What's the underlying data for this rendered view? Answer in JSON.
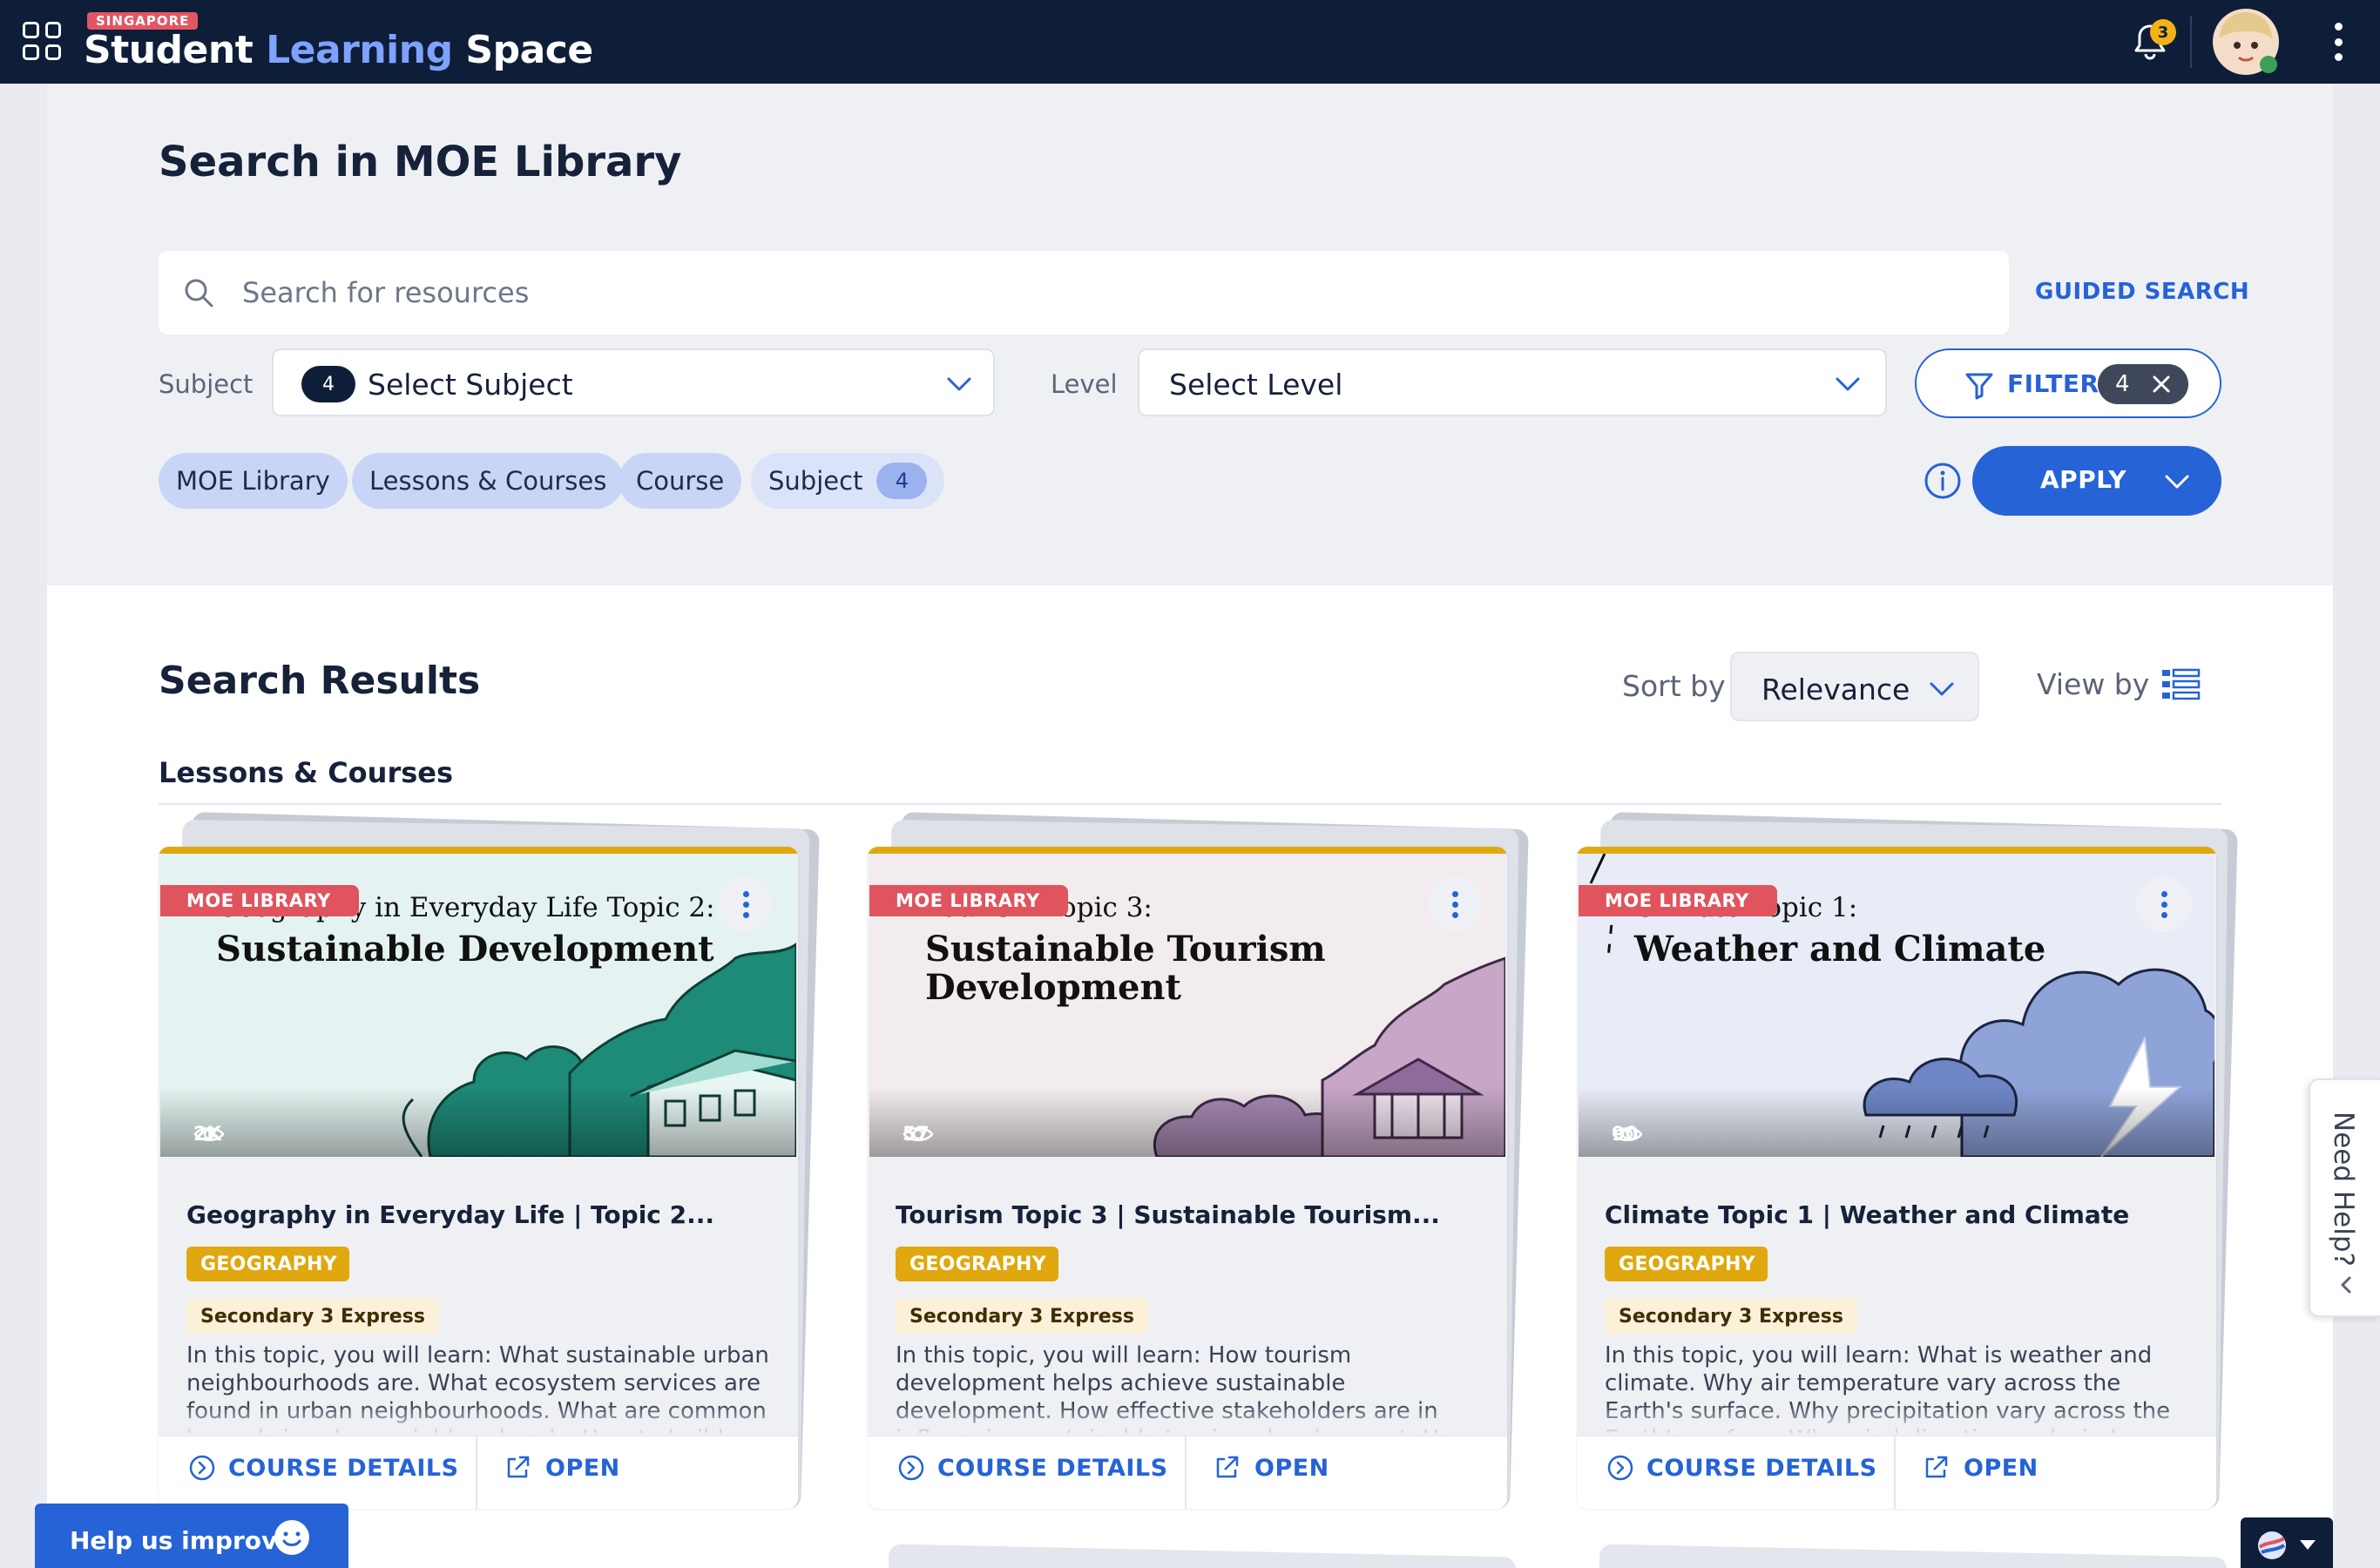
{
  "topbar": {
    "brand_tag": "SINGAPORE",
    "brand_word1": "Student",
    "brand_word2": "Learning",
    "brand_word3": "Space",
    "notification_count": "3",
    "colors": {
      "bar": "#0e1e38",
      "accent": "#7ea2ff",
      "badge": "#f3b21a"
    }
  },
  "search": {
    "page_title": "Search in MOE Library",
    "placeholder": "Search for resources",
    "value": "",
    "guided_search_label": "GUIDED SEARCH",
    "subject_label": "Subject",
    "subject_count": "4",
    "subject_select": "Select Subject",
    "level_label": "Level",
    "level_select": "Select Level",
    "filter_label": "FILTER",
    "filter_count": "4",
    "apply_label": "APPLY"
  },
  "chips": [
    {
      "label": "MOE Library"
    },
    {
      "label": "Lessons & Courses"
    },
    {
      "label": "Course"
    },
    {
      "label": "Subject",
      "count": "4"
    }
  ],
  "results": {
    "title": "Search Results",
    "sort_label": "Sort by",
    "sort_value": "Relevance",
    "view_label": "View by",
    "section_label": "Lessons & Courses",
    "course_details_label": "COURSE DETAILS",
    "open_label": "OPEN",
    "cards": [
      {
        "badge": "MOE LIBRARY",
        "thumb_kicker": "Geography in Everyday Life Topic 2:",
        "thumb_heading": "Sustainable Development",
        "views": "2K",
        "title": "Geography in Everyday Life | Topic 2...",
        "subject": "GEOGRAPHY",
        "level": "Secondary 3 Express",
        "description": "In this topic, you will learn: What sustainable urban neighbourhoods are. What ecosystem services are found in urban neighbourhoods. What are common hazards in urban neighbourhoods. How to build",
        "thumb_bg": "#e4f3f1",
        "thumb_fg": "#1e8a78"
      },
      {
        "badge": "MOE LIBRARY",
        "thumb_kicker": "Tourism Topic 3:",
        "thumb_heading": "Sustainable Tourism Development",
        "views": "57",
        "title": "Tourism Topic 3 | Sustainable Tourism...",
        "subject": "GEOGRAPHY",
        "level": "Secondary 3 Express",
        "description": "In this topic, you will learn: How tourism development helps achieve sustainable development. How effective stakeholders are in influencing sustainable tourism development. How effective the approaches in",
        "thumb_bg": "#f2ecef",
        "thumb_fg": "#a889b3"
      },
      {
        "badge": "MOE LIBRARY",
        "thumb_kicker": "Climate Topic 1:",
        "thumb_heading": "Weather and Climate",
        "views": "90",
        "title": "Climate Topic 1 | Weather and Climate",
        "subject": "GEOGRAPHY",
        "level": "Secondary 3 Express",
        "description": "In this topic, you will learn: What is weather and climate. Why air temperature vary across the Earth's surface. Why precipitation vary across the Earth's surface. Why wind direction and wind speed vary",
        "thumb_bg": "#e8ecf7",
        "thumb_fg": "#8ea3d8"
      }
    ]
  },
  "widgets": {
    "need_help": "Need Help?",
    "help_improve": "Help us improve"
  },
  "icons": {
    "apps": "apps-grid-icon",
    "notification": "bell-icon",
    "search": "search-icon",
    "filter": "filter-icon",
    "info": "info-icon",
    "list_view": "list-view-icon",
    "views": "eye-icon",
    "course_details": "chevron-circle-icon",
    "open": "external-link-icon"
  }
}
